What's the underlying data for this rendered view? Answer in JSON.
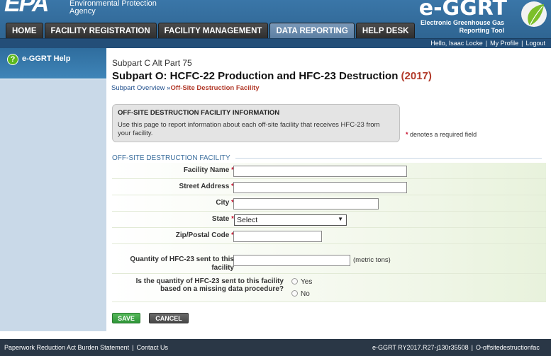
{
  "header": {
    "agency_mark": "EPA",
    "agency_line1": "Environmental Protection",
    "agency_line2": "Agency",
    "app_title": "e-GGRT",
    "app_subtitle_line1": "Electronic Greenhouse Gas",
    "app_subtitle_line2": "Reporting Tool"
  },
  "tabs": [
    {
      "label": "HOME"
    },
    {
      "label": "FACILITY REGISTRATION"
    },
    {
      "label": "FACILITY MANAGEMENT"
    },
    {
      "label": "DATA REPORTING"
    },
    {
      "label": "HELP DESK"
    }
  ],
  "user_bar": {
    "greeting": "Hello, Isaac Locke",
    "profile": "My Profile",
    "logout": "Logout"
  },
  "sidebar": {
    "help_label": "e-GGRT Help",
    "help_icon_glyph": "?"
  },
  "main": {
    "subpart_code": "Subpart C Alt Part 75",
    "title": "Subpart O: HCFC-22 Production and HFC-23 Destruction",
    "year": "(2017)",
    "breadcrumb": {
      "overview": "Subpart Overview",
      "separator": "»",
      "current": "Off-Site Destruction Facility"
    },
    "info_box": {
      "title": "OFF-SITE DESTRUCTION FACILITY INFORMATION",
      "text": "Use this page to report information about each off-site facility that receives HFC-23 from your facility."
    },
    "required_note": "denotes a required field",
    "required_star": "*",
    "legend": "OFF-SITE DESTRUCTION FACILITY",
    "fields": {
      "facility_name": {
        "label": "Facility Name",
        "value": ""
      },
      "street_address": {
        "label": "Street Address",
        "value": ""
      },
      "city": {
        "label": "City",
        "value": ""
      },
      "state": {
        "label": "State",
        "selected": "Select"
      },
      "zip": {
        "label": "Zip/Postal Code",
        "value": ""
      },
      "quantity": {
        "label_line1": "Quantity of HFC-23 sent to this",
        "label_line2": "facility",
        "value": "",
        "unit": "(metric tons)"
      },
      "missing_data": {
        "label_line1": "Is the quantity of HFC-23 sent to this facility",
        "label_line2": "based on a missing data procedure?",
        "option_yes": "Yes",
        "option_no": "No"
      }
    },
    "buttons": {
      "save": "SAVE",
      "cancel": "CANCEL"
    }
  },
  "footer": {
    "burden": "Paperwork Reduction Act Burden Statement",
    "contact": "Contact Us",
    "version": "e-GGRT RY2017.R27-j130r35508",
    "page_id": "O-offsitedestructionfac"
  },
  "colors": {
    "header_blue": "#3a76a8",
    "year_red": "#b23a2a",
    "required_red": "#c8102e",
    "save_green": "#2e9538"
  }
}
